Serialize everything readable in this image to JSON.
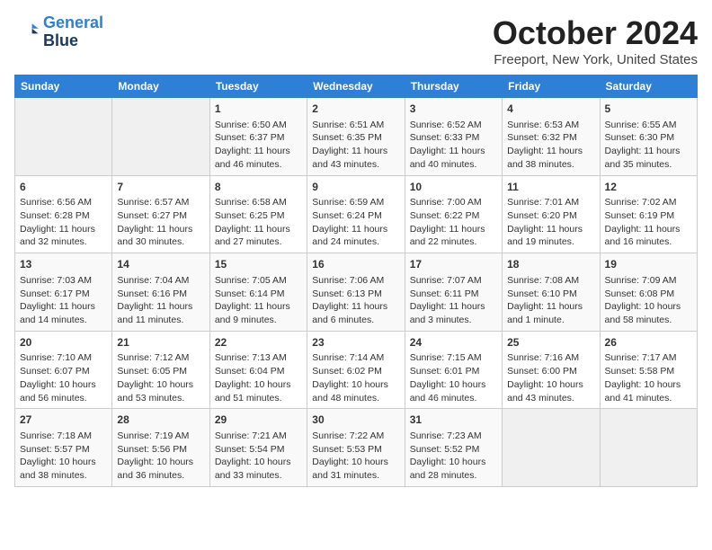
{
  "header": {
    "logo_line1": "General",
    "logo_line2": "Blue",
    "month": "October 2024",
    "location": "Freeport, New York, United States"
  },
  "weekdays": [
    "Sunday",
    "Monday",
    "Tuesday",
    "Wednesday",
    "Thursday",
    "Friday",
    "Saturday"
  ],
  "weeks": [
    [
      {
        "num": "",
        "lines": []
      },
      {
        "num": "",
        "lines": []
      },
      {
        "num": "1",
        "lines": [
          "Sunrise: 6:50 AM",
          "Sunset: 6:37 PM",
          "Daylight: 11 hours",
          "and 46 minutes."
        ]
      },
      {
        "num": "2",
        "lines": [
          "Sunrise: 6:51 AM",
          "Sunset: 6:35 PM",
          "Daylight: 11 hours",
          "and 43 minutes."
        ]
      },
      {
        "num": "3",
        "lines": [
          "Sunrise: 6:52 AM",
          "Sunset: 6:33 PM",
          "Daylight: 11 hours",
          "and 40 minutes."
        ]
      },
      {
        "num": "4",
        "lines": [
          "Sunrise: 6:53 AM",
          "Sunset: 6:32 PM",
          "Daylight: 11 hours",
          "and 38 minutes."
        ]
      },
      {
        "num": "5",
        "lines": [
          "Sunrise: 6:55 AM",
          "Sunset: 6:30 PM",
          "Daylight: 11 hours",
          "and 35 minutes."
        ]
      }
    ],
    [
      {
        "num": "6",
        "lines": [
          "Sunrise: 6:56 AM",
          "Sunset: 6:28 PM",
          "Daylight: 11 hours",
          "and 32 minutes."
        ]
      },
      {
        "num": "7",
        "lines": [
          "Sunrise: 6:57 AM",
          "Sunset: 6:27 PM",
          "Daylight: 11 hours",
          "and 30 minutes."
        ]
      },
      {
        "num": "8",
        "lines": [
          "Sunrise: 6:58 AM",
          "Sunset: 6:25 PM",
          "Daylight: 11 hours",
          "and 27 minutes."
        ]
      },
      {
        "num": "9",
        "lines": [
          "Sunrise: 6:59 AM",
          "Sunset: 6:24 PM",
          "Daylight: 11 hours",
          "and 24 minutes."
        ]
      },
      {
        "num": "10",
        "lines": [
          "Sunrise: 7:00 AM",
          "Sunset: 6:22 PM",
          "Daylight: 11 hours",
          "and 22 minutes."
        ]
      },
      {
        "num": "11",
        "lines": [
          "Sunrise: 7:01 AM",
          "Sunset: 6:20 PM",
          "Daylight: 11 hours",
          "and 19 minutes."
        ]
      },
      {
        "num": "12",
        "lines": [
          "Sunrise: 7:02 AM",
          "Sunset: 6:19 PM",
          "Daylight: 11 hours",
          "and 16 minutes."
        ]
      }
    ],
    [
      {
        "num": "13",
        "lines": [
          "Sunrise: 7:03 AM",
          "Sunset: 6:17 PM",
          "Daylight: 11 hours",
          "and 14 minutes."
        ]
      },
      {
        "num": "14",
        "lines": [
          "Sunrise: 7:04 AM",
          "Sunset: 6:16 PM",
          "Daylight: 11 hours",
          "and 11 minutes."
        ]
      },
      {
        "num": "15",
        "lines": [
          "Sunrise: 7:05 AM",
          "Sunset: 6:14 PM",
          "Daylight: 11 hours",
          "and 9 minutes."
        ]
      },
      {
        "num": "16",
        "lines": [
          "Sunrise: 7:06 AM",
          "Sunset: 6:13 PM",
          "Daylight: 11 hours",
          "and 6 minutes."
        ]
      },
      {
        "num": "17",
        "lines": [
          "Sunrise: 7:07 AM",
          "Sunset: 6:11 PM",
          "Daylight: 11 hours",
          "and 3 minutes."
        ]
      },
      {
        "num": "18",
        "lines": [
          "Sunrise: 7:08 AM",
          "Sunset: 6:10 PM",
          "Daylight: 11 hours",
          "and 1 minute."
        ]
      },
      {
        "num": "19",
        "lines": [
          "Sunrise: 7:09 AM",
          "Sunset: 6:08 PM",
          "Daylight: 10 hours",
          "and 58 minutes."
        ]
      }
    ],
    [
      {
        "num": "20",
        "lines": [
          "Sunrise: 7:10 AM",
          "Sunset: 6:07 PM",
          "Daylight: 10 hours",
          "and 56 minutes."
        ]
      },
      {
        "num": "21",
        "lines": [
          "Sunrise: 7:12 AM",
          "Sunset: 6:05 PM",
          "Daylight: 10 hours",
          "and 53 minutes."
        ]
      },
      {
        "num": "22",
        "lines": [
          "Sunrise: 7:13 AM",
          "Sunset: 6:04 PM",
          "Daylight: 10 hours",
          "and 51 minutes."
        ]
      },
      {
        "num": "23",
        "lines": [
          "Sunrise: 7:14 AM",
          "Sunset: 6:02 PM",
          "Daylight: 10 hours",
          "and 48 minutes."
        ]
      },
      {
        "num": "24",
        "lines": [
          "Sunrise: 7:15 AM",
          "Sunset: 6:01 PM",
          "Daylight: 10 hours",
          "and 46 minutes."
        ]
      },
      {
        "num": "25",
        "lines": [
          "Sunrise: 7:16 AM",
          "Sunset: 6:00 PM",
          "Daylight: 10 hours",
          "and 43 minutes."
        ]
      },
      {
        "num": "26",
        "lines": [
          "Sunrise: 7:17 AM",
          "Sunset: 5:58 PM",
          "Daylight: 10 hours",
          "and 41 minutes."
        ]
      }
    ],
    [
      {
        "num": "27",
        "lines": [
          "Sunrise: 7:18 AM",
          "Sunset: 5:57 PM",
          "Daylight: 10 hours",
          "and 38 minutes."
        ]
      },
      {
        "num": "28",
        "lines": [
          "Sunrise: 7:19 AM",
          "Sunset: 5:56 PM",
          "Daylight: 10 hours",
          "and 36 minutes."
        ]
      },
      {
        "num": "29",
        "lines": [
          "Sunrise: 7:21 AM",
          "Sunset: 5:54 PM",
          "Daylight: 10 hours",
          "and 33 minutes."
        ]
      },
      {
        "num": "30",
        "lines": [
          "Sunrise: 7:22 AM",
          "Sunset: 5:53 PM",
          "Daylight: 10 hours",
          "and 31 minutes."
        ]
      },
      {
        "num": "31",
        "lines": [
          "Sunrise: 7:23 AM",
          "Sunset: 5:52 PM",
          "Daylight: 10 hours",
          "and 28 minutes."
        ]
      },
      {
        "num": "",
        "lines": []
      },
      {
        "num": "",
        "lines": []
      }
    ]
  ]
}
